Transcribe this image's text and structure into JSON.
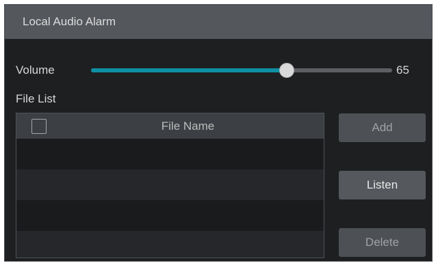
{
  "dialog": {
    "title": "Local Audio Alarm"
  },
  "volume": {
    "label": "Volume",
    "value": 65,
    "max": 100,
    "display": "65"
  },
  "file_list": {
    "label": "File List",
    "columns": [
      "File Name"
    ],
    "rows": []
  },
  "buttons": {
    "add": "Add",
    "listen": "Listen",
    "delete": "Delete"
  },
  "colors": {
    "accent": "#0f8fa3",
    "titlebar": "#54575c",
    "background": "#1e1f21"
  }
}
